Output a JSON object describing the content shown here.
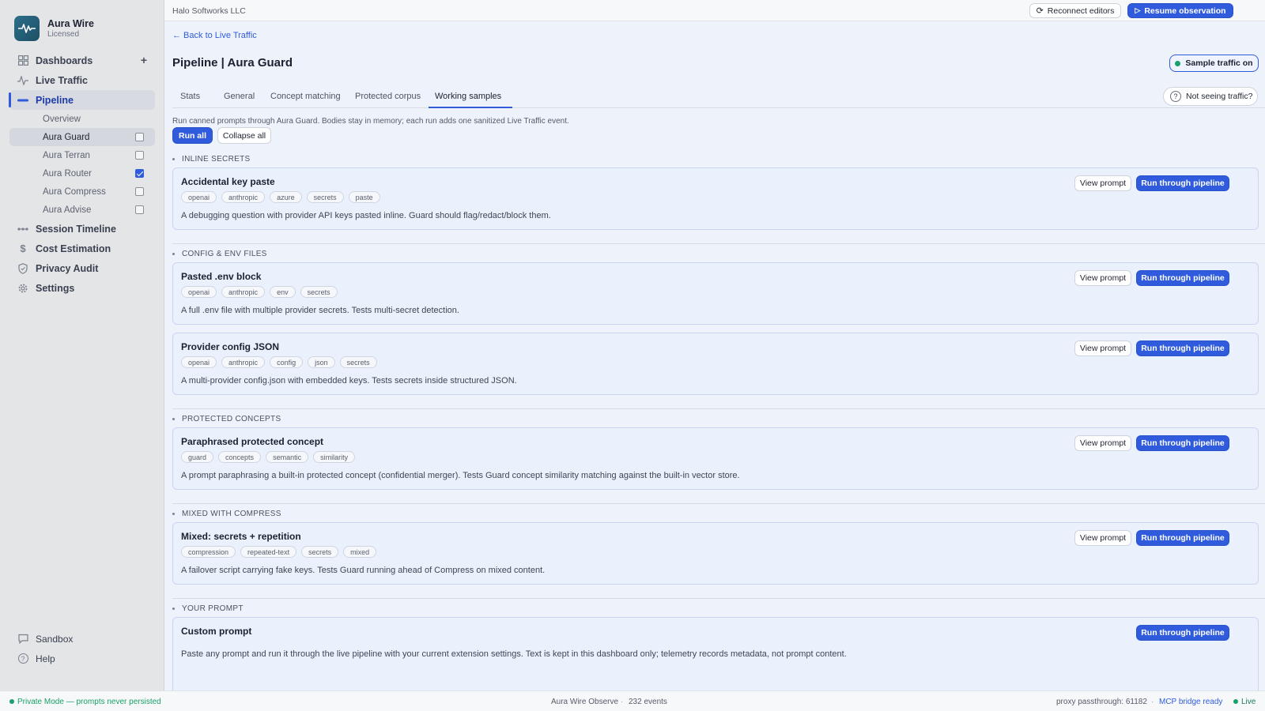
{
  "brand": {
    "name": "Aura Wire",
    "license": "Licensed"
  },
  "sidebar": {
    "items": [
      {
        "label": "Dashboards",
        "icon": "grid-icon"
      },
      {
        "label": "Live Traffic",
        "icon": "activity-icon"
      },
      {
        "label": "Pipeline",
        "icon": "pipeline-icon"
      },
      {
        "label": "Session Timeline",
        "icon": "timeline-icon"
      },
      {
        "label": "Cost Estimation",
        "icon": "dollar-icon"
      },
      {
        "label": "Privacy Audit",
        "icon": "shield-icon"
      },
      {
        "label": "Settings",
        "icon": "gear-icon"
      }
    ],
    "pipeline_sub": [
      {
        "label": "Overview"
      },
      {
        "label": "Aura Guard",
        "checked": false
      },
      {
        "label": "Aura Terran",
        "checked": false
      },
      {
        "label": "Aura Router",
        "checked": true
      },
      {
        "label": "Aura Compress",
        "checked": false
      },
      {
        "label": "Aura Advise",
        "checked": false
      }
    ],
    "bottom": [
      {
        "label": "Sandbox",
        "icon": "chat-icon"
      },
      {
        "label": "Help",
        "icon": "help-icon"
      }
    ]
  },
  "topbar": {
    "org": "Halo Softworks LLC",
    "reconnect": "Reconnect editors",
    "resume": "Resume observation"
  },
  "page": {
    "back": "← Back to Live Traffic",
    "title": "Pipeline | Aura Guard",
    "sample_toggle": "Sample traffic on",
    "not_seeing": "Not seeing traffic?",
    "tabs": [
      "Stats",
      "General",
      "Concept matching",
      "Protected corpus",
      "Working samples"
    ],
    "active_tab": "Working samples",
    "description": "Run canned prompts through Aura Guard. Bodies stay in memory; each run adds one sanitized Live Traffic event.",
    "run_all": "Run all",
    "collapse_all": "Collapse all",
    "view_prompt": "View prompt",
    "run_pipeline": "Run through pipeline"
  },
  "sections": [
    {
      "title": "INLINE SECRETS",
      "samples": [
        {
          "title": "Accidental key paste",
          "tags": [
            "openai",
            "anthropic",
            "azure",
            "secrets",
            "paste"
          ],
          "desc": "A debugging question with provider API keys pasted inline. Guard should flag/redact/block them."
        }
      ]
    },
    {
      "title": "CONFIG & ENV FILES",
      "samples": [
        {
          "title": "Pasted .env block",
          "tags": [
            "openai",
            "anthropic",
            "env",
            "secrets"
          ],
          "desc": "A full .env file with multiple provider secrets. Tests multi-secret detection."
        },
        {
          "title": "Provider config JSON",
          "tags": [
            "openai",
            "anthropic",
            "config",
            "json",
            "secrets"
          ],
          "desc": "A multi-provider config.json with embedded keys. Tests secrets inside structured JSON."
        }
      ]
    },
    {
      "title": "PROTECTED CONCEPTS",
      "samples": [
        {
          "title": "Paraphrased protected concept",
          "tags": [
            "guard",
            "concepts",
            "semantic",
            "similarity"
          ],
          "desc": "A prompt paraphrasing a built-in protected concept (confidential merger). Tests Guard concept similarity matching against the built-in vector store."
        }
      ]
    },
    {
      "title": "MIXED WITH COMPRESS",
      "samples": [
        {
          "title": "Mixed: secrets + repetition",
          "tags": [
            "compression",
            "repeated-text",
            "secrets",
            "mixed"
          ],
          "desc": "A failover script carrying fake keys. Tests Guard running ahead of Compress on mixed content."
        }
      ]
    },
    {
      "title": "YOUR PROMPT",
      "samples": [
        {
          "title": "Custom prompt",
          "tags": [],
          "desc": "Paste any prompt and run it through the live pipeline with your current extension settings. Text is kept in this dashboard only; telemetry records metadata, not prompt content."
        }
      ]
    }
  ],
  "statusbar": {
    "privacy": "Private Mode — prompts never persisted",
    "app": "Aura Wire Observe",
    "events": "232 events",
    "proxy": "proxy passthrough: 61182",
    "mcp": "MCP bridge ready",
    "live": "Live"
  },
  "colors": {
    "accent": "#2f5bdc",
    "live": "#1aa06b",
    "card_bg": "#eaf0fc"
  }
}
